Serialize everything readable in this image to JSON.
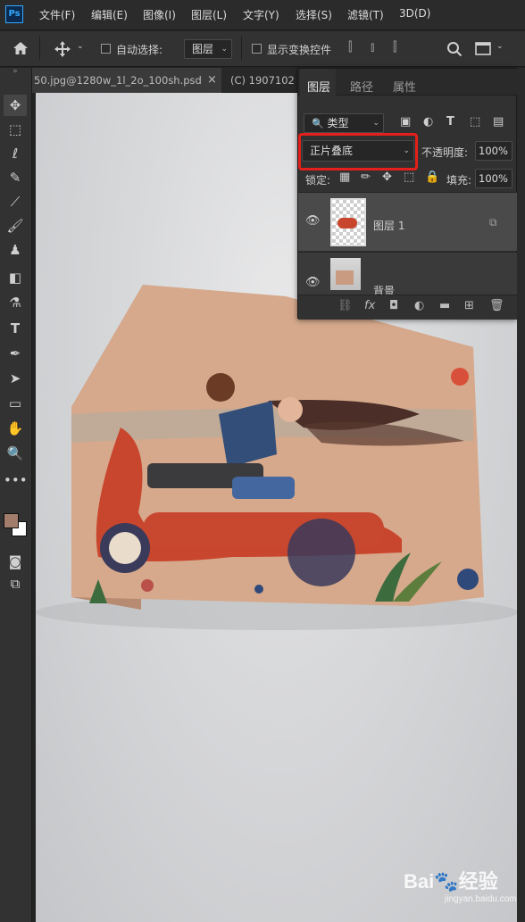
{
  "app": {
    "logo": "Ps"
  },
  "menu": [
    "文件(F)",
    "编辑(E)",
    "图像(I)",
    "图层(L)",
    "文字(Y)",
    "选择(S)",
    "滤镜(T)",
    "3D(D)"
  ],
  "options": {
    "home_icon": "home-icon",
    "move_icon": "move-icon",
    "auto_select_label": "自动选择:",
    "auto_select_value": "图层",
    "show_transform_label": "显示变换控件"
  },
  "tabs": [
    {
      "label": "50.jpg@1280w_1l_2o_100sh.psd",
      "close": "×"
    },
    {
      "label": "(C) 1907102",
      "close": ""
    }
  ],
  "layers_panel": {
    "tabs": [
      "图层",
      "路径",
      "属性"
    ],
    "filter_label": "类型",
    "blend_mode": "正片叠底",
    "opacity_label": "不透明度:",
    "opacity_value": "100%",
    "lock_label": "锁定:",
    "fill_label": "填充:",
    "fill_value": "100%",
    "layers": [
      {
        "name": "图层 1",
        "visible": true,
        "selected": true
      },
      {
        "name": "背景",
        "visible": true,
        "selected": false
      }
    ]
  },
  "watermark": {
    "brand": "Bai🐾经验",
    "sub": "jingyan.baidu.com"
  },
  "colors": {
    "foreground": "#a37d6c",
    "background": "#ffffff",
    "accent": "#e3201b"
  }
}
